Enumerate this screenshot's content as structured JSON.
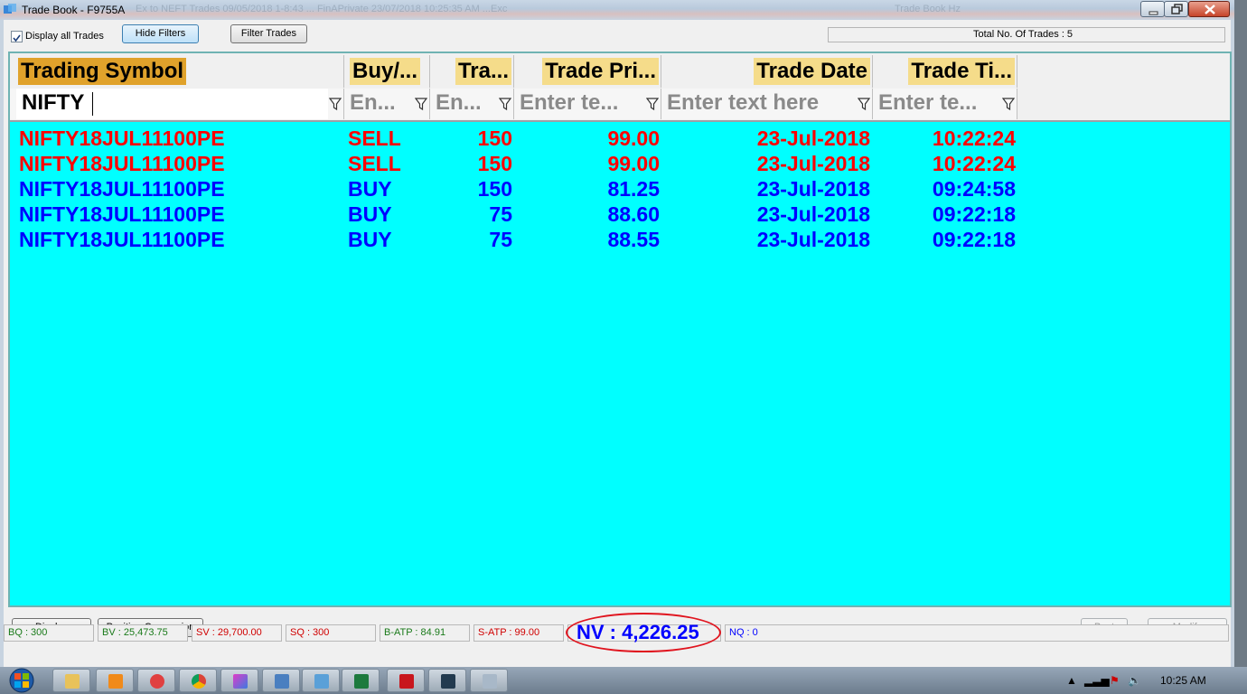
{
  "window": {
    "title": "Trade Book - F9755A",
    "background_title": "Ex to NEFT Trades 09/05/2018  1-8:43 ... FinAPrivate  23/07/2018  10:25:35 AM ...Exc",
    "background_title_right": "Trade Book  Hz"
  },
  "toolbar": {
    "display_all_label": "Display all Trades",
    "display_all_checked": true,
    "hide_filters_label": "Hide Filters",
    "filter_trades_label": "Filter Trades",
    "total_trades": "Total No. Of Trades : 5"
  },
  "grid": {
    "columns": [
      {
        "label": "Trading Symbol",
        "header_color": "#e0a22b",
        "filter_value": "NIFTY",
        "filter_placeholder": ""
      },
      {
        "label": "Buy/...",
        "header_color": "#f5dc8a",
        "filter_value": "",
        "filter_placeholder": "En..."
      },
      {
        "label": "Tra...",
        "header_color": "#f5dc8a",
        "filter_value": "",
        "filter_placeholder": "En..."
      },
      {
        "label": "Trade Pri...",
        "header_color": "#f5dc8a",
        "filter_value": "",
        "filter_placeholder": "Enter te..."
      },
      {
        "label": "Trade Date",
        "header_color": "#f5dc8a",
        "filter_value": "",
        "filter_placeholder": "Enter text here"
      },
      {
        "label": "Trade Ti...",
        "header_color": "#f5dc8a",
        "filter_value": "",
        "filter_placeholder": "Enter te..."
      }
    ],
    "rows": [
      {
        "side_class": "sell",
        "symbol": "NIFTY18JUL11100PE",
        "side": "SELL",
        "qty": "150",
        "price": "99.00",
        "date": "23-Jul-2018",
        "time": "10:22:24"
      },
      {
        "side_class": "sell",
        "symbol": "NIFTY18JUL11100PE",
        "side": "SELL",
        "qty": "150",
        "price": "99.00",
        "date": "23-Jul-2018",
        "time": "10:22:24"
      },
      {
        "side_class": "buy",
        "symbol": "NIFTY18JUL11100PE",
        "side": "BUY",
        "qty": "150",
        "price": "81.25",
        "date": "23-Jul-2018",
        "time": "09:24:58"
      },
      {
        "side_class": "buy",
        "symbol": "NIFTY18JUL11100PE",
        "side": "BUY",
        "qty": "75",
        "price": "88.60",
        "date": "23-Jul-2018",
        "time": "09:22:18"
      },
      {
        "side_class": "buy",
        "symbol": "NIFTY18JUL11100PE",
        "side": "BUY",
        "qty": "75",
        "price": "88.55",
        "date": "23-Jul-2018",
        "time": "09:22:18"
      }
    ],
    "buy_color": "#0000ff",
    "sell_color": "#ff0000",
    "background": "#00ffff"
  },
  "actions": {
    "display_label": "Display",
    "position_conversion_label": "Position Conversion",
    "bust_label": "Bust",
    "modify_label": "Modify"
  },
  "status": {
    "bq": "BQ : 300",
    "bv": "BV : 25,473.75",
    "sv": "SV : 29,700.00",
    "sq": "SQ : 300",
    "batp": "B-ATP : 84.91",
    "satp": "S-ATP : 99.00",
    "nv": "NV : 4,226.25",
    "nq": "NQ : 0"
  },
  "taskbar": {
    "clock": "10:25 AM",
    "apps": [
      "explorer-icon",
      "media-player-icon",
      "lifebuoy-icon",
      "chrome-icon",
      "triangle-app-icon",
      "network-icon",
      "window-app-icon",
      "excel-icon",
      "pdf-icon",
      "chart-app-icon",
      "calculator-icon"
    ]
  }
}
